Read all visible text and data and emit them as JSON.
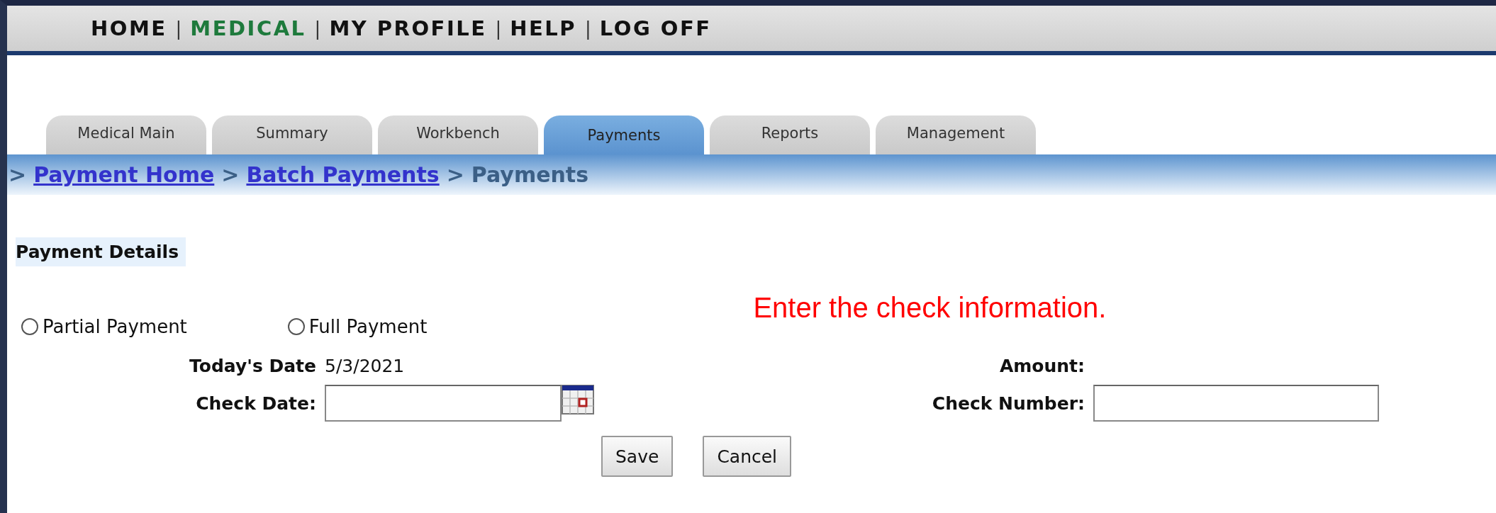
{
  "top_nav": {
    "separator": "|",
    "items": [
      {
        "label": "HOME",
        "selected": false
      },
      {
        "label": "MEDICAL",
        "selected": true
      },
      {
        "label": "MY PROFILE",
        "selected": false
      },
      {
        "label": "HELP",
        "selected": false
      },
      {
        "label": "LOG OFF",
        "selected": false
      }
    ]
  },
  "tabs": [
    {
      "label": "Medical Main",
      "selected": false
    },
    {
      "label": "Summary",
      "selected": false
    },
    {
      "label": "Workbench",
      "selected": false
    },
    {
      "label": "Payments",
      "selected": true
    },
    {
      "label": "Reports",
      "selected": false
    },
    {
      "label": "Management",
      "selected": false
    }
  ],
  "breadcrumb": {
    "separator": ">",
    "items": [
      {
        "label": "Payment Home",
        "kind": "link"
      },
      {
        "label": "Batch Payments",
        "kind": "link"
      },
      {
        "label": "Payments",
        "kind": "current"
      }
    ]
  },
  "section_title": "Payment Details",
  "instruction": "Enter the check information.",
  "payment_type": [
    {
      "label": "Partial Payment",
      "selected": false
    },
    {
      "label": "Full Payment",
      "selected": false
    }
  ],
  "fields": [
    {
      "label": "Today's Date",
      "kind": "text",
      "value": "5/3/2021"
    },
    {
      "label": "Amount:",
      "kind": "text"
    },
    {
      "label": "Check Date:",
      "kind": "date_input"
    },
    {
      "label": "Check Number:",
      "kind": "input"
    }
  ],
  "buttons": [
    "Save",
    "Cancel"
  ]
}
